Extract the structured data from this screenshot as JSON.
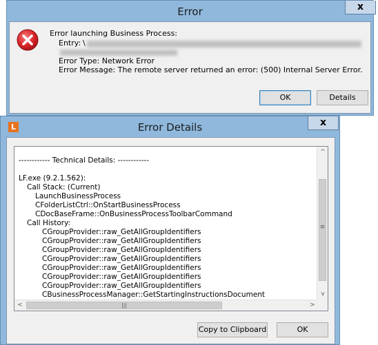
{
  "error_dialog": {
    "title": "Error",
    "close_label": "x",
    "heading": "Error launching Business Process:",
    "entry_label": "Entry:",
    "entry_value_prefix": "\\",
    "error_type": "Error Type: Network Error",
    "error_message": "Error Message: The remote server returned an error: (500) Internal Server Error.",
    "ok_label": "OK",
    "details_label": "Details"
  },
  "details_dialog": {
    "app_icon_letter": "L",
    "title": "Error Details",
    "close_label": "x",
    "lines": [
      "------------ Technical Details: ------------",
      "",
      "LF.exe (9.2.1.562):",
      "Call Stack: (Current)",
      "LaunchBusinessProcess",
      "CFolderListCtrl::OnStartBusinessProcess",
      "CDocBaseFrame::OnBusinessProcessToolbarCommand",
      "Call History:",
      "CGroupProvider::raw_GetAllGroupIdentifiers",
      "CGroupProvider::raw_GetAllGroupIdentifiers",
      "CGroupProvider::raw_GetAllGroupIdentifiers",
      "CGroupProvider::raw_GetAllGroupIdentifiers",
      "CGroupProvider::raw_GetAllGroupIdentifiers",
      "CGroupProvider::raw_GetAllGroupIdentifiers",
      "CGroupProvider::raw_GetAllGroupIdentifiers",
      "CBusinessProcessManager::GetStartingInstructionsDocument"
    ],
    "copy_label": "Copy to Clipboard",
    "ok_label": "OK",
    "scroll_up_glyph": "^",
    "scroll_down_glyph": "v",
    "scroll_left_glyph": "<",
    "scroll_right_glyph": ">",
    "grip_glyph": "|||",
    "vgrip_glyph": "≡"
  },
  "colors": {
    "frame": "#8fb8dc",
    "client": "#f0f0f0",
    "error_red": "#d9252a",
    "app_orange": "#e8731e"
  }
}
